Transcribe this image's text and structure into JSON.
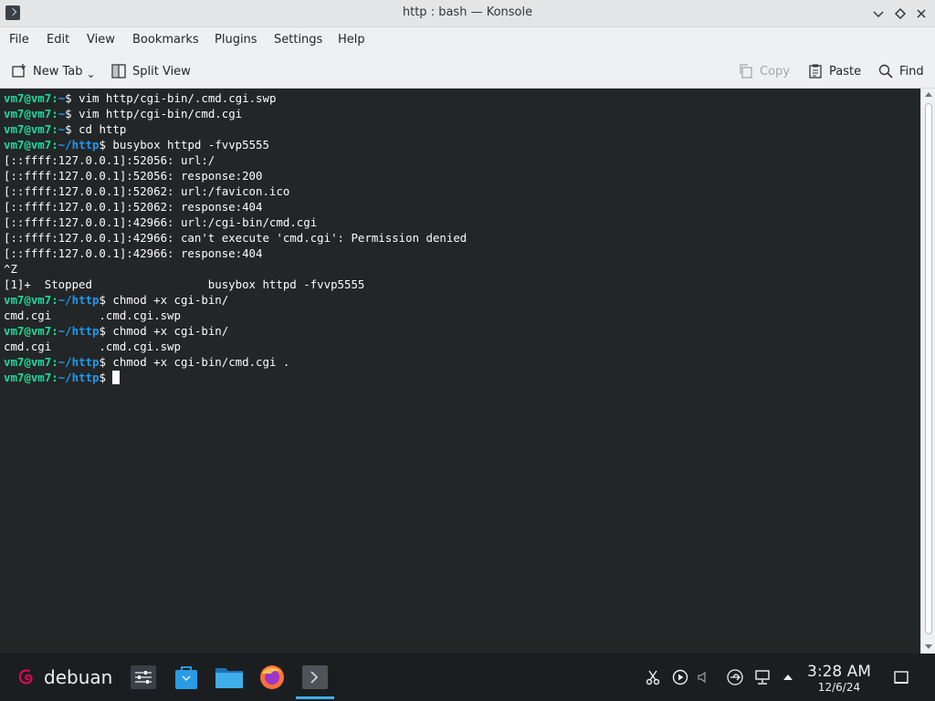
{
  "window": {
    "title": "http : bash — Konsole"
  },
  "menu": [
    "File",
    "Edit",
    "View",
    "Bookmarks",
    "Plugins",
    "Settings",
    "Help"
  ],
  "toolbar": {
    "new_tab": "New Tab",
    "split_view": "Split View",
    "copy": "Copy",
    "paste": "Paste",
    "find": "Find"
  },
  "terminal": {
    "lines": [
      {
        "user": "vm7@vm7",
        "path": "~",
        "cmd": " vim http/cgi-bin/.cmd.cgi.swp"
      },
      {
        "user": "vm7@vm7",
        "path": "~",
        "cmd": " vim http/cgi-bin/cmd.cgi"
      },
      {
        "user": "vm7@vm7",
        "path": "~",
        "cmd": " cd http"
      },
      {
        "user": "vm7@vm7",
        "path": "~/http",
        "cmd": " busybox httpd -fvvp5555"
      },
      {
        "text": "[::ffff:127.0.0.1]:52056: url:/"
      },
      {
        "text": "[::ffff:127.0.0.1]:52056: response:200"
      },
      {
        "text": "[::ffff:127.0.0.1]:52062: url:/favicon.ico"
      },
      {
        "text": "[::ffff:127.0.0.1]:52062: response:404"
      },
      {
        "text": "[::ffff:127.0.0.1]:42966: url:/cgi-bin/cmd.cgi"
      },
      {
        "text": "[::ffff:127.0.0.1]:42966: can't execute 'cmd.cgi': Permission denied"
      },
      {
        "text": "[::ffff:127.0.0.1]:42966: response:404"
      },
      {
        "text": "^Z"
      },
      {
        "text": "[1]+  Stopped                 busybox httpd -fvvp5555"
      },
      {
        "user": "vm7@vm7",
        "path": "~/http",
        "cmd": " chmod +x cgi-bin/"
      },
      {
        "text": "cmd.cgi       .cmd.cgi.swp"
      },
      {
        "user": "vm7@vm7",
        "path": "~/http",
        "cmd": " chmod +x cgi-bin/"
      },
      {
        "text": "cmd.cgi       .cmd.cgi.swp"
      },
      {
        "user": "vm7@vm7",
        "path": "~/http",
        "cmd": " chmod +x cgi-bin/cmd.cgi ."
      },
      {
        "user": "vm7@vm7",
        "path": "~/http",
        "cmd": " ",
        "cursor": true
      }
    ]
  },
  "taskbar": {
    "launcher_label": "debuan",
    "clock_time": "3:28 AM",
    "clock_date": "12/6/24"
  },
  "colors": {
    "terminal_bg": "#232627",
    "prompt_user": "#1cdc9a",
    "prompt_path": "#1d99f3",
    "accent": "#3daee9"
  }
}
